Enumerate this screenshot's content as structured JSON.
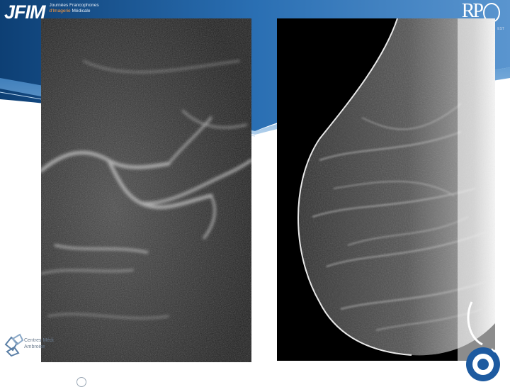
{
  "header": {
    "jfim_logo": "JFIM",
    "jfim_line1": "Journées Francophones",
    "jfim_line2_prefix": "d'Imagerie",
    "jfim_line2_suffix": " Médicale",
    "rpo_logo_text": "RP",
    "rpo_subtext": "EST"
  },
  "footer": {
    "centres_line1": "Centres Médi",
    "centres_line2": "Ambroise"
  },
  "colors": {
    "banner_dark": "#0d3f74",
    "banner_mid": "#2a6fb3",
    "banner_light": "#7fb0de",
    "accent_orange": "#ff9a3c"
  },
  "images": {
    "left": "mammogram-magnified-detail",
    "right": "mammogram-lateral-view"
  }
}
